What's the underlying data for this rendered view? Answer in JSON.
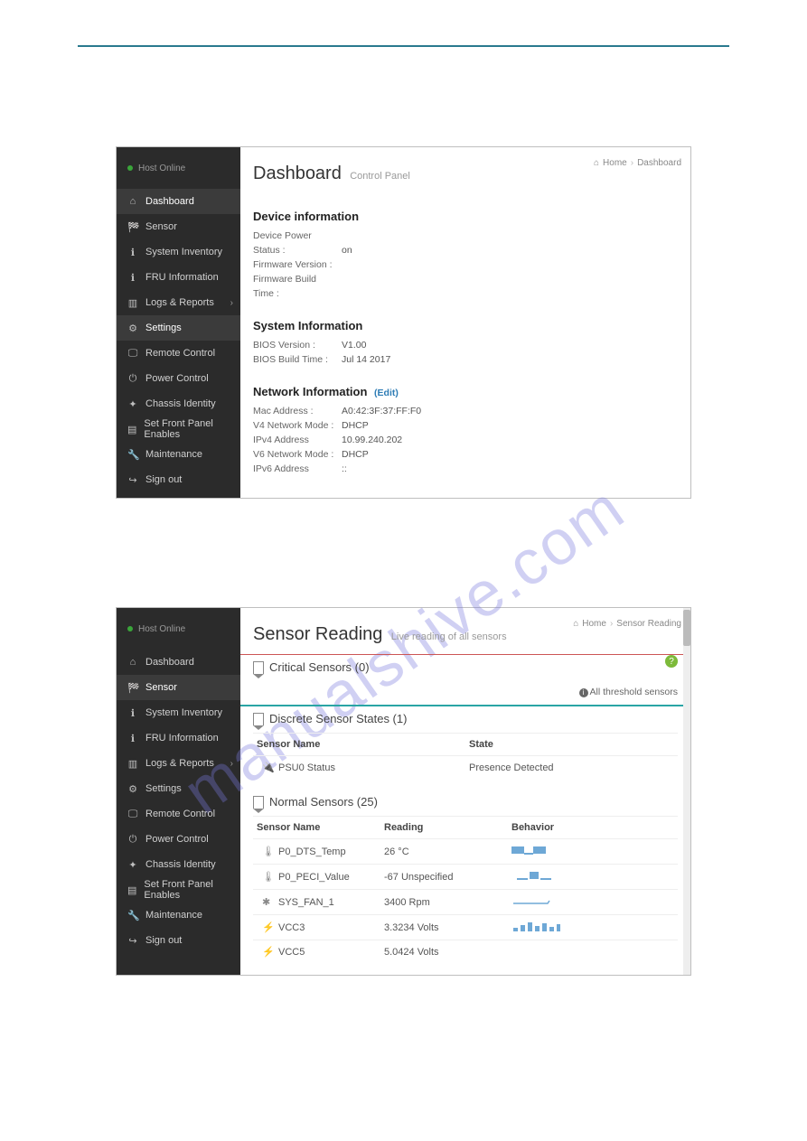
{
  "watermark": "manualshive.com",
  "shot1": {
    "host_status": "Host Online",
    "nav": [
      {
        "icon": "home",
        "label": "Dashboard",
        "name": "sidebar-item-dashboard",
        "active": true
      },
      {
        "icon": "gauge",
        "label": "Sensor",
        "name": "sidebar-item-sensor"
      },
      {
        "icon": "info",
        "label": "System Inventory",
        "name": "sidebar-item-system-inventory"
      },
      {
        "icon": "info",
        "label": "FRU Information",
        "name": "sidebar-item-fru-information"
      },
      {
        "icon": "chart",
        "label": "Logs & Reports",
        "name": "sidebar-item-logs-reports",
        "chev": true
      },
      {
        "icon": "gear",
        "label": "Settings",
        "name": "sidebar-item-settings",
        "active": true
      },
      {
        "icon": "monitor",
        "label": "Remote Control",
        "name": "sidebar-item-remote-control"
      },
      {
        "icon": "power",
        "label": "Power Control",
        "name": "sidebar-item-power-control"
      },
      {
        "icon": "id",
        "label": "Chassis Identity",
        "name": "sidebar-item-chassis-identity"
      },
      {
        "icon": "panel",
        "label": "Set Front Panel Enables",
        "name": "sidebar-item-set-front-panel"
      },
      {
        "icon": "wrench",
        "label": "Maintenance",
        "name": "sidebar-item-maintenance"
      },
      {
        "icon": "signout",
        "label": "Sign out",
        "name": "sidebar-item-sign-out"
      }
    ],
    "title": "Dashboard",
    "subtitle": "Control Panel",
    "crumbs": {
      "home_icon": "home",
      "home_label": "Home",
      "current": "Dashboard"
    },
    "device_section": "Device information",
    "device_kv": [
      {
        "label": "Device Power Status :",
        "val": "on"
      },
      {
        "label": "Firmware Version :",
        "val": ""
      },
      {
        "label": "Firmware Build Time :",
        "val": ""
      }
    ],
    "system_section": "System Information",
    "system_kv": [
      {
        "label": "BIOS Version :",
        "val": "V1.00"
      },
      {
        "label": "BIOS Build Time :",
        "val": "Jul 14 2017"
      }
    ],
    "network_section": "Network Information",
    "network_edit": "(Edit)",
    "network_kv": [
      {
        "label": "Mac Address :",
        "val": "A0:42:3F:37:FF:F0"
      },
      {
        "label": "V4 Network Mode :",
        "val": "DHCP"
      },
      {
        "label": "IPv4 Address",
        "val": "10.99.240.202"
      },
      {
        "label": "V6 Network Mode :",
        "val": "DHCP"
      },
      {
        "label": "IPv6 Address",
        "val": "::"
      }
    ]
  },
  "shot2": {
    "host_status": "Host Online",
    "nav": [
      {
        "icon": "home",
        "label": "Dashboard",
        "name": "sidebar-item-dashboard"
      },
      {
        "icon": "gauge",
        "label": "Sensor",
        "name": "sidebar-item-sensor",
        "active": true
      },
      {
        "icon": "info",
        "label": "System Inventory",
        "name": "sidebar-item-system-inventory"
      },
      {
        "icon": "info",
        "label": "FRU Information",
        "name": "sidebar-item-fru-information"
      },
      {
        "icon": "chart",
        "label": "Logs & Reports",
        "name": "sidebar-item-logs-reports",
        "chev": true
      },
      {
        "icon": "gear",
        "label": "Settings",
        "name": "sidebar-item-settings"
      },
      {
        "icon": "monitor",
        "label": "Remote Control",
        "name": "sidebar-item-remote-control"
      },
      {
        "icon": "power",
        "label": "Power Control",
        "name": "sidebar-item-power-control"
      },
      {
        "icon": "id",
        "label": "Chassis Identity",
        "name": "sidebar-item-chassis-identity"
      },
      {
        "icon": "panel",
        "label": "Set Front Panel Enables",
        "name": "sidebar-item-set-front-panel"
      },
      {
        "icon": "wrench",
        "label": "Maintenance",
        "name": "sidebar-item-maintenance"
      },
      {
        "icon": "signout",
        "label": "Sign out",
        "name": "sidebar-item-sign-out"
      }
    ],
    "title": "Sensor Reading",
    "subtitle": "Live reading of all sensors",
    "crumbs": {
      "home_icon": "home",
      "home_label": "Home",
      "current": "Sensor Reading"
    },
    "critical_head": "Critical Sensors (0)",
    "all_threshold": "All threshold sensors",
    "discrete_head": "Discrete Sensor States (1)",
    "discrete_cols": {
      "name": "Sensor Name",
      "state": "State"
    },
    "discrete_rows": [
      {
        "icon": "plug",
        "name": "PSU0 Status",
        "state": "Presence Detected"
      }
    ],
    "normal_head": "Normal Sensors (25)",
    "normal_cols": {
      "name": "Sensor Name",
      "reading": "Reading",
      "behavior": "Behavior"
    },
    "normal_rows": [
      {
        "icon": "therm",
        "name": "P0_DTS_Temp",
        "reading": "26 °C",
        "spark": "bar-blue"
      },
      {
        "icon": "therm",
        "name": "P0_PECI_Value",
        "reading": "-67 Unspecified",
        "spark": "bar-mid"
      },
      {
        "icon": "fan",
        "name": "SYS_FAN_1",
        "reading": "3400 Rpm",
        "spark": "line-flat"
      },
      {
        "icon": "bolt",
        "name": "VCC3",
        "reading": "3.3234 Volts",
        "spark": "bars"
      },
      {
        "icon": "bolt",
        "name": "VCC5",
        "reading": "5.0424 Volts",
        "spark": ""
      }
    ],
    "help": "?"
  },
  "icons": {
    "home": "⌂",
    "gauge": "🏁",
    "info": "ℹ",
    "chart": "▥",
    "gear": "⚙",
    "monitor": "🖵",
    "power": "⏻",
    "id": "✦",
    "panel": "▤",
    "wrench": "🔧",
    "signout": "↪",
    "plug": "🔌",
    "therm": "🌡",
    "fan": "✱",
    "bolt": "⚡"
  }
}
